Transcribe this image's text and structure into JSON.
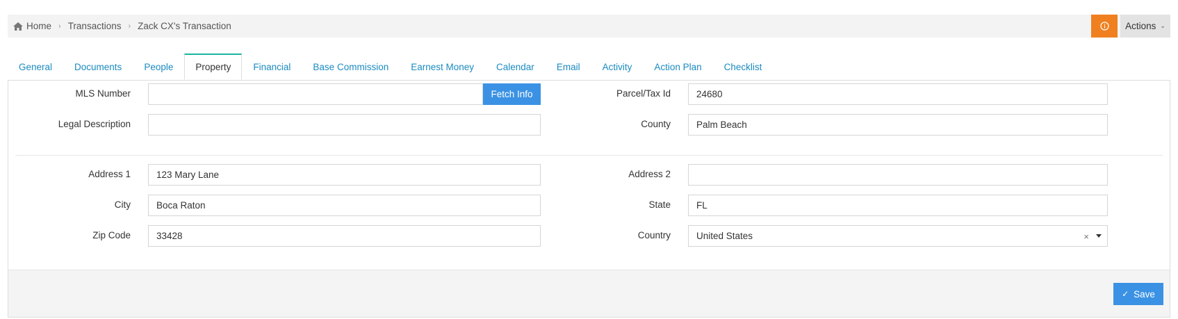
{
  "breadcrumb": {
    "home": "Home",
    "transactions": "Transactions",
    "current": "Zack CX's Transaction",
    "separator": "›"
  },
  "header": {
    "info_icon": "info-icon",
    "info_glyph": "ⓘ",
    "actions_label": "Actions",
    "accent_color": "#f0801f"
  },
  "tabs": [
    {
      "label": "General"
    },
    {
      "label": "Documents"
    },
    {
      "label": "People"
    },
    {
      "label": "Property",
      "active": true
    },
    {
      "label": "Financial"
    },
    {
      "label": "Base Commission"
    },
    {
      "label": "Earnest Money"
    },
    {
      "label": "Calendar"
    },
    {
      "label": "Email"
    },
    {
      "label": "Activity"
    },
    {
      "label": "Action Plan"
    },
    {
      "label": "Checklist"
    }
  ],
  "form": {
    "mls_number": {
      "label": "MLS Number",
      "value": ""
    },
    "fetch_info": "Fetch Info",
    "parcel_tax_id": {
      "label": "Parcel/Tax Id",
      "value": "24680"
    },
    "legal_description": {
      "label": "Legal Description",
      "value": ""
    },
    "county": {
      "label": "County",
      "value": "Palm Beach"
    },
    "address1": {
      "label": "Address 1",
      "value": "123 Mary Lane"
    },
    "address2": {
      "label": "Address 2",
      "value": ""
    },
    "city": {
      "label": "City",
      "value": "Boca Raton"
    },
    "state": {
      "label": "State",
      "value": "FL"
    },
    "zip_code": {
      "label": "Zip Code",
      "value": "33428"
    },
    "country": {
      "label": "Country",
      "value": "United States",
      "clear_glyph": "×"
    }
  },
  "footer": {
    "save_label": "Save",
    "check_glyph": "✓"
  }
}
